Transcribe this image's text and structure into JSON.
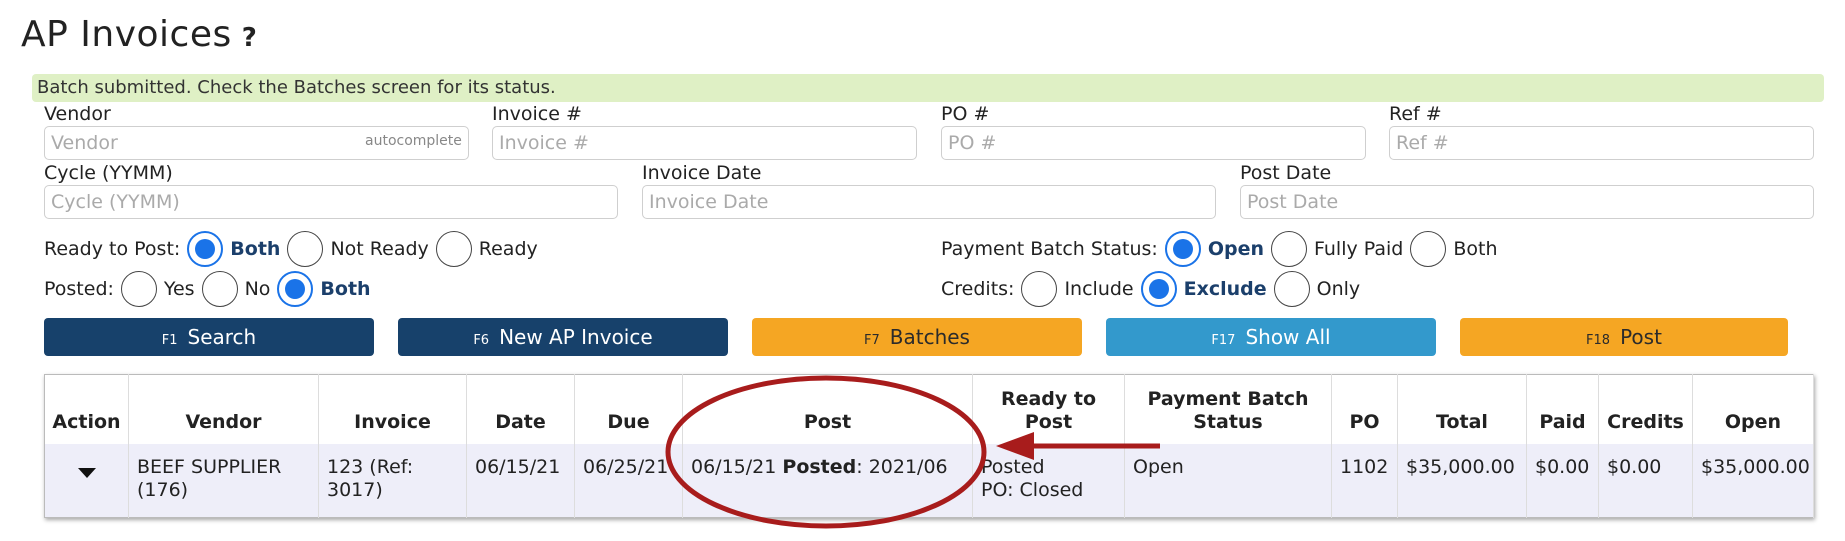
{
  "page": {
    "title": "AP Invoices",
    "help_icon": "?"
  },
  "banner": {
    "text": "Batch submitted. Check the Batches screen for its status."
  },
  "filters": {
    "vendor": {
      "label": "Vendor",
      "placeholder": "Vendor",
      "tag": "autocomplete"
    },
    "invoice": {
      "label": "Invoice #",
      "placeholder": "Invoice #"
    },
    "po": {
      "label": "PO #",
      "placeholder": "PO #"
    },
    "ref": {
      "label": "Ref #",
      "placeholder": "Ref #"
    },
    "cycle": {
      "label": "Cycle (YYMM)",
      "placeholder": "Cycle (YYMM)"
    },
    "invoice_date": {
      "label": "Invoice Date",
      "placeholder": "Invoice Date"
    },
    "post_date": {
      "label": "Post Date",
      "placeholder": "Post Date"
    },
    "ready_to_post": {
      "label": "Ready to Post:",
      "options": [
        "Both",
        "Not Ready",
        "Ready"
      ],
      "selected": "Both"
    },
    "posted": {
      "label": "Posted:",
      "options": [
        "Yes",
        "No",
        "Both"
      ],
      "selected": "Both"
    },
    "payment_batch_status": {
      "label": "Payment Batch Status:",
      "options": [
        "Open",
        "Fully Paid",
        "Both"
      ],
      "selected": "Open"
    },
    "credits": {
      "label": "Credits:",
      "options": [
        "Include",
        "Exclude",
        "Only"
      ],
      "selected": "Exclude"
    }
  },
  "buttons": [
    {
      "key": "F1",
      "label": "Search"
    },
    {
      "key": "F6",
      "label": "New AP Invoice"
    },
    {
      "key": "F7",
      "label": "Batches"
    },
    {
      "key": "F17",
      "label": "Show All"
    },
    {
      "key": "F18",
      "label": "Post"
    }
  ],
  "table": {
    "headers": [
      "Action",
      "Vendor",
      "Invoice",
      "Date",
      "Due",
      "Post",
      "Ready to Post",
      "Payment Batch Status",
      "PO",
      "Total",
      "Paid",
      "Credits",
      "Open"
    ],
    "rows": [
      {
        "vendor": "BEEF SUPPLIER (176)",
        "invoice": "123 (Ref: 3017)",
        "date": "06/15/21",
        "due": "06/25/21",
        "post_date": "06/15/21",
        "posted_label": "Posted",
        "posted_cycle": ": 2021/06",
        "ready_line1": "Posted",
        "ready_line2": "PO: Closed",
        "payment_status": "Open",
        "po": "1102",
        "total": "$35,000.00",
        "paid": "$0.00",
        "credits": "$0.00",
        "open": "$35,000.00"
      }
    ]
  },
  "colors": {
    "banner_bg": "#dff0c5",
    "navy": "#17416b",
    "orange": "#f5a623",
    "blue": "#3399cc",
    "radio_selected": "#1a73e8",
    "annotation": "#a81c1c"
  },
  "icons": {
    "row_action": "caret-down-icon",
    "help": "question-mark-icon"
  }
}
